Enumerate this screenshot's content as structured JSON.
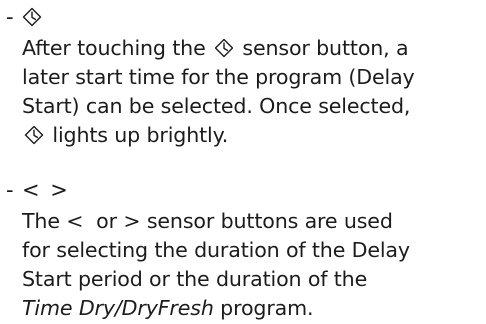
{
  "items": [
    {
      "dash": "-",
      "icon": "delay-start-icon",
      "lines": [
        [
          "After touching the ",
          "{icon}",
          " sensor button, a"
        ],
        [
          "later start time for the program (Delay"
        ],
        [
          "Start) can be selected. Once selected,"
        ],
        [
          "{icon}",
          " lights up brightly."
        ]
      ]
    },
    {
      "dash": "-",
      "head_left": "<",
      "head_right": ">",
      "line1_a": "The ",
      "line1_left": "<",
      "line1_b": "  or ",
      "line1_right": ">",
      "line1_c": " sensor buttons are used",
      "line2": "for selecting the duration of the Delay",
      "line3": "Start period or the duration of the",
      "line4_italic": "Time Dry/DryFresh",
      "line4_rest": " program."
    }
  ],
  "text": {
    "item1_line1_a": "After touching the ",
    "item1_line1_b": " sensor button, a",
    "item1_line2": "later start time for the program (Delay",
    "item1_line3": "Start) can be selected. Once selected,",
    "item1_line4_b": " lights up brightly."
  }
}
